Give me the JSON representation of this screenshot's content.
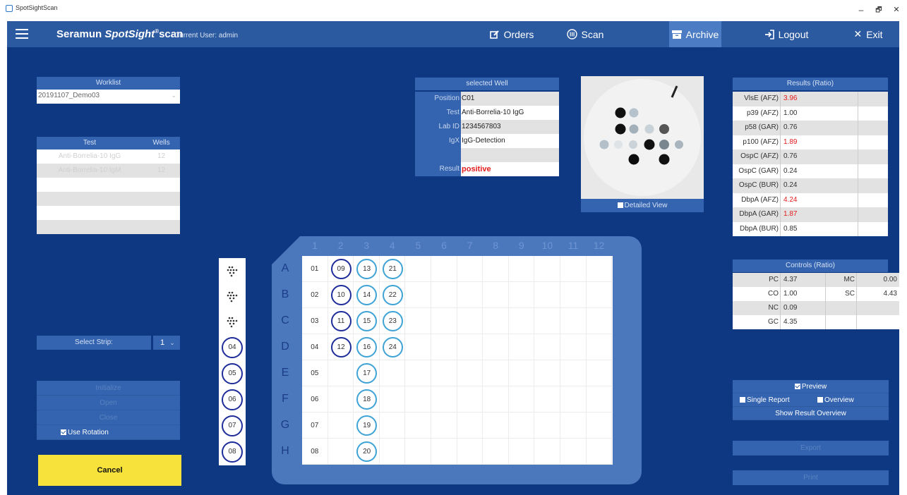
{
  "window": {
    "title": "SpotSightScan",
    "minimize": "–",
    "maximize": "🗗",
    "close": "✕"
  },
  "nav": {
    "brand_a": "Seramun ",
    "brand_b": "SpotSight",
    "brand_reg": "®",
    "brand_c": "scan",
    "current_user": "Current User: admin",
    "orders": "Orders",
    "scan": "Scan",
    "archive": "Archive",
    "logout": "Logout",
    "exit": "Exit"
  },
  "worklist": {
    "header": "Worklist",
    "value": "20191107_Demo03"
  },
  "tests": {
    "col_test": "Test",
    "col_wells": "Wells",
    "rows": [
      {
        "test": "Anti-Borrelia-10 IgG",
        "wells": "12"
      },
      {
        "test": "Anti-Borrelia-10 IgM",
        "wells": "12"
      },
      {
        "test": "",
        "wells": ""
      },
      {
        "test": "",
        "wells": ""
      },
      {
        "test": "",
        "wells": ""
      },
      {
        "test": "",
        "wells": ""
      }
    ]
  },
  "strip_select": {
    "label": "Select Strip:",
    "value": "1"
  },
  "actions": {
    "initialize": "Initialize",
    "open": "Open",
    "close": "Close",
    "use_rotation": "Use Rotation"
  },
  "cancel": "Cancel",
  "strip_wells": [
    "04",
    "05",
    "06",
    "07",
    "08"
  ],
  "plate": {
    "columns": [
      "1",
      "2",
      "3",
      "4",
      "5",
      "6",
      "7",
      "8",
      "9",
      "10",
      "11",
      "12"
    ],
    "rows": [
      "A",
      "B",
      "C",
      "D",
      "E",
      "F",
      "G",
      "H"
    ],
    "col1": [
      "01",
      "02",
      "03",
      "04",
      "05",
      "06",
      "07",
      "08"
    ],
    "col2": [
      "09",
      "10",
      "11",
      "12"
    ],
    "col3": [
      "13",
      "14",
      "15",
      "16",
      "17",
      "18",
      "19",
      "20"
    ],
    "col4": [
      "21",
      "22",
      "23",
      "24"
    ]
  },
  "selected_well": {
    "header": "selected Well",
    "position_label": "Position",
    "position": "C01",
    "test_label": "Test",
    "test": "Anti-Borrelia-10 IgG",
    "labid_label": "Lab ID",
    "labid": "1234567803",
    "igx_label": "IgX",
    "igx": "IgG-Detection",
    "result_label": "Result",
    "result": "positive"
  },
  "detailed_view": "Detailed View",
  "results": {
    "header": "Results (Ratio)",
    "rows": [
      {
        "name": "VlsE (AFZ)",
        "value": "3.96",
        "flag": true
      },
      {
        "name": "p39 (AFZ)",
        "value": "1.00",
        "flag": false
      },
      {
        "name": "p58 (GAR)",
        "value": "0.76",
        "flag": false
      },
      {
        "name": "p100 (AFZ)",
        "value": "1.89",
        "flag": true
      },
      {
        "name": "OspC (AFZ)",
        "value": "0.76",
        "flag": false
      },
      {
        "name": "OspC (GAR)",
        "value": "0.24",
        "flag": false
      },
      {
        "name": "OspC (BUR)",
        "value": "0.24",
        "flag": false
      },
      {
        "name": "DbpA (AFZ)",
        "value": "4.24",
        "flag": true
      },
      {
        "name": "DbpA (GAR)",
        "value": "1.87",
        "flag": true
      },
      {
        "name": "DbpA (BUR)",
        "value": "0.85",
        "flag": false
      }
    ]
  },
  "controls": {
    "header": "Controls (Ratio)",
    "rows": [
      {
        "n1": "PC",
        "v1": "4.37",
        "n2": "MC",
        "v2": "0.00"
      },
      {
        "n1": "CO",
        "v1": "1.00",
        "n2": "SC",
        "v2": "4.43"
      },
      {
        "n1": "NC",
        "v1": "0.09",
        "n2": "",
        "v2": ""
      },
      {
        "n1": "GC",
        "v1": "4.35",
        "n2": "",
        "v2": ""
      }
    ]
  },
  "report": {
    "preview": "Preview",
    "single_report": "Single Report",
    "overview": "Overview",
    "show_result_overview": "Show Result Overview",
    "export": "Export",
    "print": "Print"
  },
  "colors": {
    "nav": "#2c5aa0",
    "background": "#0e3882",
    "panel": "#3464b0",
    "positive": "#e31b1b",
    "cancel": "#f6e23a"
  }
}
